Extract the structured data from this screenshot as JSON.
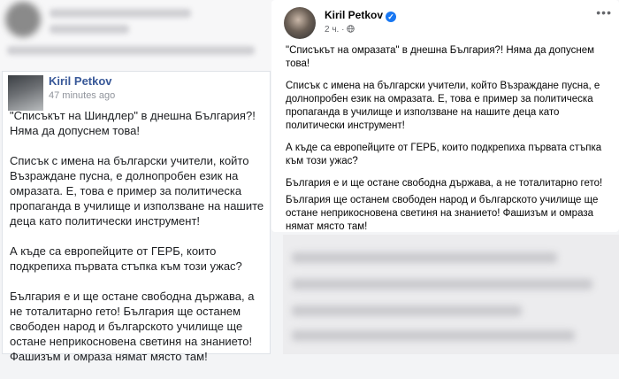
{
  "left_post": {
    "author": "Kiril Petkov",
    "time": "47 minutes ago",
    "paragraphs": [
      "\"Списъкът на Шиндлер\" в днешна България?! Няма да допуснем това!",
      "Списък с имена на български учители, който Възраждане пусна, е долнопробен език на омразата. Е, това е пример за политическа пропаганда в училище и използване на нашите деца като политически инструмент!",
      "А къде са европейците от ГЕРБ, които подкрепиха първата стъпка към този ужас?",
      "България е и ще остане свободна държава, а не тоталитарно гето! България ще останем свободен народ и българското училище ще остане неприкосновена светиня на знанието! Фашизъм и омраза нямат място там!"
    ]
  },
  "right_post": {
    "author": "Kiril Petkov",
    "time": "2 ч.",
    "separator": "·",
    "audience_icon": "globe-icon",
    "verified_icon": "verified-badge-icon",
    "more_icon": "more-options-icon",
    "paragraphs": [
      "\"Списъкът на омразата\" в днешна България?! Няма да допуснем това!",
      "Списък с имена на български учители, който Възраждане пусна, е долнопробен език на омразата. Е, това е пример за политическа пропаганда в училище и използване на нашите деца като политически инструмент!",
      "А къде са европейците от ГЕРБ, които подкрепиха първата стъпка към този ужас?",
      "България е и ще остане свободна държава, а не тоталитарно гето!",
      "България ще останем свободен народ и българското училище ще остане неприкосновена светиня на знанието! Фашизъм и омраза нямат място там!"
    ]
  },
  "colors": {
    "link_name_old": "#385898",
    "verified_blue": "#1877f2",
    "meta_gray": "#65676b"
  }
}
